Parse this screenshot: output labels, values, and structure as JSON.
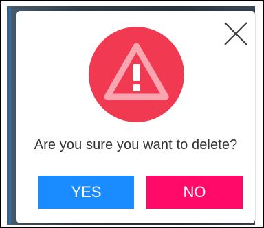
{
  "dialog": {
    "message": "Are you sure you want to delete?",
    "yes_label": "YES",
    "no_label": "NO",
    "close_icon": "close-icon",
    "alert_icon": "warning-triangle-icon"
  },
  "colors": {
    "yes_button": "#1a8cff",
    "no_button": "#ff0a69",
    "alert_circle": "#f13a52",
    "dialog_background": "#ffffff"
  }
}
